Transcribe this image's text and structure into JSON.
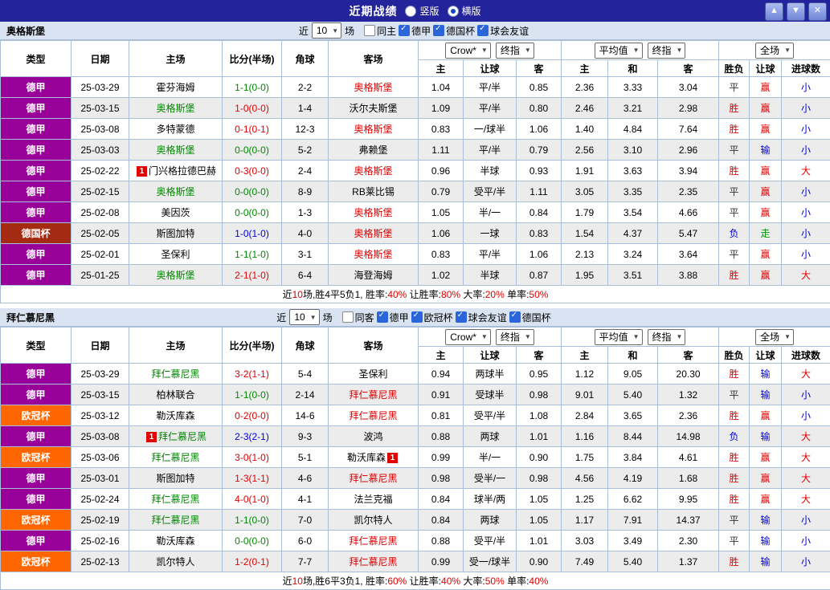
{
  "titlebar": {
    "title": "近期战绩",
    "radios": [
      {
        "label": "竖版",
        "checked": false
      },
      {
        "label": "横版",
        "checked": true
      }
    ]
  },
  "table_head": {
    "type": "类型",
    "date": "日期",
    "home": "主场",
    "score": "比分(半场)",
    "corner": "角球",
    "away": "客场",
    "h_home": "主",
    "h_line": "让球",
    "h_away": "客",
    "e_home": "主",
    "e_draw": "和",
    "e_away": "客",
    "res": "胜负",
    "hres": "让球",
    "goals": "进球数"
  },
  "colors": {
    "type": {
      "德甲": "#990099",
      "德国杯": "#a52a12",
      "欧冠杯": "#ff6600"
    },
    "result": {
      "胜": "#e00000",
      "平": "#333333",
      "负": "#0000dd"
    },
    "handicap_result": {
      "赢": "#e00000",
      "输": "#0000dd",
      "走": "#009900"
    },
    "goals": {
      "大": "#e00000",
      "小": "#0000dd"
    },
    "score_by_result": {
      "胜": "#e00000",
      "平": "#008800",
      "负": "#0000dd"
    },
    "focal_home": "#008800",
    "focal_away": "#e00000"
  },
  "sections": [
    {
      "team": "奥格斯堡",
      "filter": {
        "near": "近",
        "count": "10",
        "games": "场",
        "checks": [
          {
            "label": "同主",
            "checked": false
          },
          {
            "label": "德甲",
            "checked": true
          },
          {
            "label": "德国杯",
            "checked": true
          },
          {
            "label": "球会友谊",
            "checked": true
          }
        ]
      },
      "selects": {
        "company1": "Crow*",
        "time1": "终指",
        "company2": "平均值",
        "time2": "终指",
        "scope": "全场"
      },
      "rows": [
        {
          "type": "德甲",
          "date": "25-03-29",
          "home": "霍芬海姆",
          "score": "1-1(0-0)",
          "corner": "2-2",
          "away": "奥格斯堡",
          "away_focal": true,
          "ah": [
            "1.04",
            "平/半",
            "0.85"
          ],
          "eu": [
            "2.36",
            "3.33",
            "3.04"
          ],
          "res": "平",
          "hres": "赢",
          "goals": "小"
        },
        {
          "type": "德甲",
          "date": "25-03-15",
          "home": "奥格斯堡",
          "home_focal": true,
          "score": "1-0(0-0)",
          "corner": "1-4",
          "away": "沃尔夫斯堡",
          "ah": [
            "1.09",
            "平/半",
            "0.80"
          ],
          "eu": [
            "2.46",
            "3.21",
            "2.98"
          ],
          "res": "胜",
          "hres": "赢",
          "goals": "小"
        },
        {
          "type": "德甲",
          "date": "25-03-08",
          "home": "多特蒙德",
          "score": "0-1(0-1)",
          "corner": "12-3",
          "away": "奥格斯堡",
          "away_focal": true,
          "ah": [
            "0.83",
            "一/球半",
            "1.06"
          ],
          "eu": [
            "1.40",
            "4.84",
            "7.64"
          ],
          "res": "胜",
          "hres": "赢",
          "goals": "小"
        },
        {
          "type": "德甲",
          "date": "25-03-03",
          "home": "奥格斯堡",
          "home_focal": true,
          "score": "0-0(0-0)",
          "corner": "5-2",
          "away": "弗赖堡",
          "ah": [
            "1.11",
            "平/半",
            "0.79"
          ],
          "eu": [
            "2.56",
            "3.10",
            "2.96"
          ],
          "res": "平",
          "hres": "输",
          "goals": "小"
        },
        {
          "type": "德甲",
          "date": "25-02-22",
          "home": "门兴格拉德巴赫",
          "home_badge_pre": "1",
          "score": "0-3(0-0)",
          "corner": "2-4",
          "away": "奥格斯堡",
          "away_focal": true,
          "ah": [
            "0.96",
            "半球",
            "0.93"
          ],
          "eu": [
            "1.91",
            "3.63",
            "3.94"
          ],
          "res": "胜",
          "hres": "赢",
          "goals": "大"
        },
        {
          "type": "德甲",
          "date": "25-02-15",
          "home": "奥格斯堡",
          "home_focal": true,
          "score": "0-0(0-0)",
          "corner": "8-9",
          "away": "RB莱比锡",
          "ah": [
            "0.79",
            "受平/半",
            "1.11"
          ],
          "eu": [
            "3.05",
            "3.35",
            "2.35"
          ],
          "res": "平",
          "hres": "赢",
          "goals": "小"
        },
        {
          "type": "德甲",
          "date": "25-02-08",
          "home": "美因茨",
          "score": "0-0(0-0)",
          "corner": "1-3",
          "away": "奥格斯堡",
          "away_focal": true,
          "ah": [
            "1.05",
            "半/一",
            "0.84"
          ],
          "eu": [
            "1.79",
            "3.54",
            "4.66"
          ],
          "res": "平",
          "hres": "赢",
          "goals": "小"
        },
        {
          "type": "德国杯",
          "date": "25-02-05",
          "home": "斯图加特",
          "score": "1-0(1-0)",
          "corner": "4-0",
          "away": "奥格斯堡",
          "away_focal": true,
          "ah": [
            "1.06",
            "一球",
            "0.83"
          ],
          "eu": [
            "1.54",
            "4.37",
            "5.47"
          ],
          "res": "负",
          "hres": "走",
          "goals": "小"
        },
        {
          "type": "德甲",
          "date": "25-02-01",
          "home": "圣保利",
          "score": "1-1(1-0)",
          "corner": "3-1",
          "away": "奥格斯堡",
          "away_focal": true,
          "ah": [
            "0.83",
            "平/半",
            "1.06"
          ],
          "eu": [
            "2.13",
            "3.24",
            "3.64"
          ],
          "res": "平",
          "hres": "赢",
          "goals": "小"
        },
        {
          "type": "德甲",
          "date": "25-01-25",
          "home": "奥格斯堡",
          "home_focal": true,
          "score": "2-1(1-0)",
          "corner": "6-4",
          "away": "海登海姆",
          "ah": [
            "1.02",
            "半球",
            "0.87"
          ],
          "eu": [
            "1.95",
            "3.51",
            "3.88"
          ],
          "res": "胜",
          "hres": "赢",
          "goals": "大"
        }
      ],
      "summary": [
        {
          "t": "近"
        },
        {
          "t": "10",
          "c": "red"
        },
        {
          "t": "场,胜4平5负1, 胜率:"
        },
        {
          "t": "40%",
          "c": "red"
        },
        {
          "t": " 让胜率:"
        },
        {
          "t": "80%",
          "c": "red"
        },
        {
          "t": " 大率:"
        },
        {
          "t": "20%",
          "c": "red"
        },
        {
          "t": " 单率:"
        },
        {
          "t": "50%",
          "c": "red"
        }
      ]
    },
    {
      "team": "拜仁慕尼黑",
      "filter": {
        "near": "近",
        "count": "10",
        "games": "场",
        "checks": [
          {
            "label": "同客",
            "checked": false
          },
          {
            "label": "德甲",
            "checked": true
          },
          {
            "label": "欧冠杯",
            "checked": true
          },
          {
            "label": "球会友谊",
            "checked": true
          },
          {
            "label": "德国杯",
            "checked": true
          }
        ]
      },
      "selects": {
        "company1": "Crow*",
        "time1": "终指",
        "company2": "平均值",
        "time2": "终指",
        "scope": "全场"
      },
      "rows": [
        {
          "type": "德甲",
          "date": "25-03-29",
          "home": "拜仁慕尼黑",
          "home_focal": true,
          "score": "3-2(1-1)",
          "corner": "5-4",
          "away": "圣保利",
          "ah": [
            "0.94",
            "两球半",
            "0.95"
          ],
          "eu": [
            "1.12",
            "9.05",
            "20.30"
          ],
          "res": "胜",
          "hres": "输",
          "goals": "大"
        },
        {
          "type": "德甲",
          "date": "25-03-15",
          "home": "柏林联合",
          "score": "1-1(0-0)",
          "corner": "2-14",
          "away": "拜仁慕尼黑",
          "away_focal": true,
          "ah": [
            "0.91",
            "受球半",
            "0.98"
          ],
          "eu": [
            "9.01",
            "5.40",
            "1.32"
          ],
          "res": "平",
          "hres": "输",
          "goals": "小"
        },
        {
          "type": "欧冠杯",
          "date": "25-03-12",
          "home": "勒沃库森",
          "score": "0-2(0-0)",
          "corner": "14-6",
          "away": "拜仁慕尼黑",
          "away_focal": true,
          "ah": [
            "0.81",
            "受平/半",
            "1.08"
          ],
          "eu": [
            "2.84",
            "3.65",
            "2.36"
          ],
          "res": "胜",
          "hres": "赢",
          "goals": "小"
        },
        {
          "type": "德甲",
          "date": "25-03-08",
          "home": "拜仁慕尼黑",
          "home_focal": true,
          "home_badge_pre": "1",
          "score": "2-3(2-1)",
          "corner": "9-3",
          "away": "波鸿",
          "ah": [
            "0.88",
            "两球",
            "1.01"
          ],
          "eu": [
            "1.16",
            "8.44",
            "14.98"
          ],
          "res": "负",
          "hres": "输",
          "goals": "大"
        },
        {
          "type": "欧冠杯",
          "date": "25-03-06",
          "home": "拜仁慕尼黑",
          "home_focal": true,
          "score": "3-0(1-0)",
          "corner": "5-1",
          "away": "勒沃库森",
          "away_badge_post": "1",
          "ah": [
            "0.99",
            "半/一",
            "0.90"
          ],
          "eu": [
            "1.75",
            "3.84",
            "4.61"
          ],
          "res": "胜",
          "hres": "赢",
          "goals": "大"
        },
        {
          "type": "德甲",
          "date": "25-03-01",
          "home": "斯图加特",
          "score": "1-3(1-1)",
          "corner": "4-6",
          "away": "拜仁慕尼黑",
          "away_focal": true,
          "ah": [
            "0.98",
            "受半/一",
            "0.98"
          ],
          "eu": [
            "4.56",
            "4.19",
            "1.68"
          ],
          "res": "胜",
          "hres": "赢",
          "goals": "大"
        },
        {
          "type": "德甲",
          "date": "25-02-24",
          "home": "拜仁慕尼黑",
          "home_focal": true,
          "score": "4-0(1-0)",
          "corner": "4-1",
          "away": "法兰克福",
          "ah": [
            "0.84",
            "球半/两",
            "1.05"
          ],
          "eu": [
            "1.25",
            "6.62",
            "9.95"
          ],
          "res": "胜",
          "hres": "赢",
          "goals": "大"
        },
        {
          "type": "欧冠杯",
          "date": "25-02-19",
          "home": "拜仁慕尼黑",
          "home_focal": true,
          "score": "1-1(0-0)",
          "corner": "7-0",
          "away": "凯尔特人",
          "ah": [
            "0.84",
            "两球",
            "1.05"
          ],
          "eu": [
            "1.17",
            "7.91",
            "14.37"
          ],
          "res": "平",
          "hres": "输",
          "goals": "小"
        },
        {
          "type": "德甲",
          "date": "25-02-16",
          "home": "勒沃库森",
          "score": "0-0(0-0)",
          "corner": "6-0",
          "away": "拜仁慕尼黑",
          "away_focal": true,
          "ah": [
            "0.88",
            "受平/半",
            "1.01"
          ],
          "eu": [
            "3.03",
            "3.49",
            "2.30"
          ],
          "res": "平",
          "hres": "输",
          "goals": "小"
        },
        {
          "type": "欧冠杯",
          "date": "25-02-13",
          "home": "凯尔特人",
          "score": "1-2(0-1)",
          "corner": "7-7",
          "away": "拜仁慕尼黑",
          "away_focal": true,
          "ah": [
            "0.99",
            "受一/球半",
            "0.90"
          ],
          "eu": [
            "7.49",
            "5.40",
            "1.37"
          ],
          "res": "胜",
          "hres": "输",
          "goals": "小"
        }
      ],
      "summary": [
        {
          "t": "近"
        },
        {
          "t": "10",
          "c": "red"
        },
        {
          "t": "场,胜6平3负1, 胜率:"
        },
        {
          "t": "60%",
          "c": "red"
        },
        {
          "t": " 让胜率:"
        },
        {
          "t": "40%",
          "c": "red"
        },
        {
          "t": " 大率:"
        },
        {
          "t": "50%",
          "c": "red"
        },
        {
          "t": " 单率:"
        },
        {
          "t": "40%",
          "c": "red"
        }
      ]
    }
  ]
}
